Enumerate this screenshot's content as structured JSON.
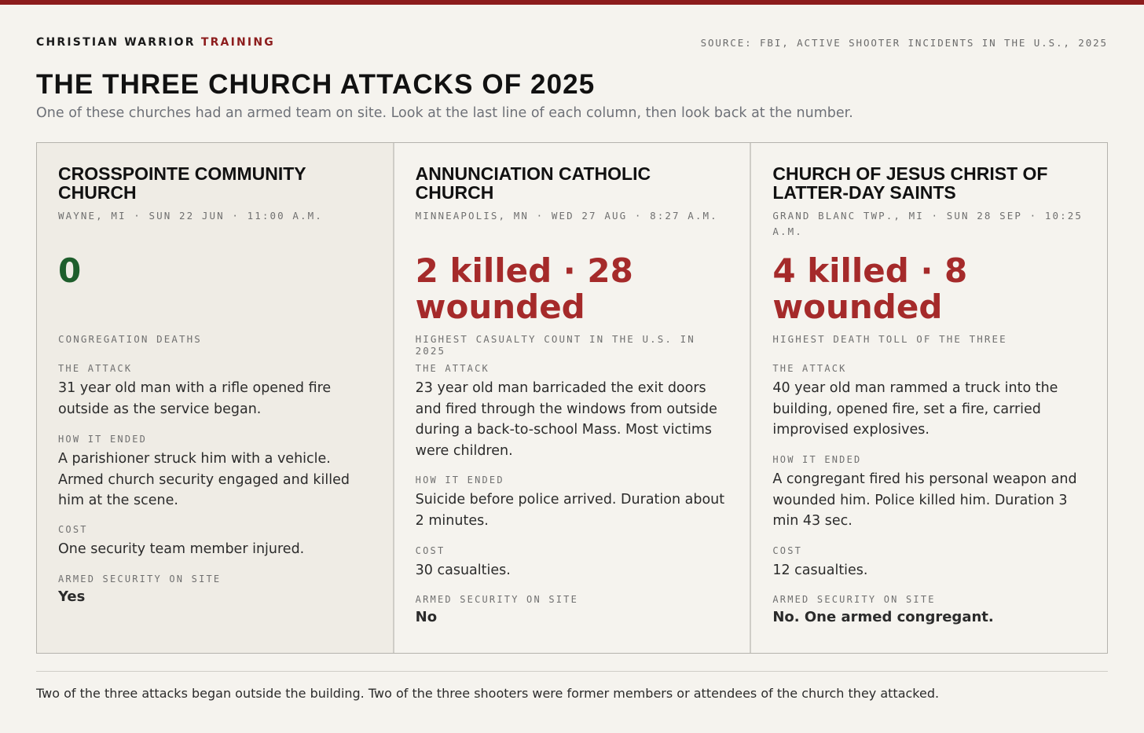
{
  "brand": {
    "primary": "CHRISTIAN WARRIOR",
    "accent": "TRAINING"
  },
  "source": "SOURCE: FBI, ACTIVE SHOOTER INCIDENTS IN THE U.S., 2025",
  "title": "THE THREE CHURCH ATTACKS OF 2025",
  "subtitle": "One of these churches had an armed team on site. Look at the last line of each column, then look back at the number.",
  "colors": {
    "accent": "#8c1c1c",
    "good": "#1e5e2c",
    "bad": "#a52a2a",
    "background": "#f5f3ee"
  },
  "labels": {
    "attack": "THE ATTACK",
    "ended": "HOW IT ENDED",
    "cost": "COST",
    "security": "ARMED SECURITY ON SITE"
  },
  "cards": [
    {
      "name": "CROSSPOINTE COMMUNITY CHURCH",
      "meta": "WAYNE, MI · SUN 22 JUN · 11:00 A.M.",
      "figure": "0",
      "caption": "CONGREGATION DEATHS",
      "attack": "31 year old man with a rifle opened fire outside as the service began.",
      "ended": "A parishioner struck him with a vehicle. Armed church security engaged and killed him at the scene.",
      "cost": "One security team member injured.",
      "security": "Yes"
    },
    {
      "name": "ANNUNCIATION CATHOLIC CHURCH",
      "meta": "MINNEAPOLIS, MN · WED 27 AUG · 8:27 A.M.",
      "figure": "2 killed · 28 wounded",
      "caption": "HIGHEST CASUALTY COUNT IN THE U.S. IN 2025",
      "attack": "23 year old man barricaded the exit doors and fired through the windows from outside during a back-to-school Mass. Most victims were children.",
      "ended": "Suicide before police arrived. Duration about 2 minutes.",
      "cost": "30 casualties.",
      "security": "No"
    },
    {
      "name": "CHURCH OF JESUS CHRIST OF LATTER-DAY SAINTS",
      "meta": "GRAND BLANC TWP., MI · SUN 28 SEP · 10:25 A.M.",
      "figure": "4 killed · 8 wounded",
      "caption": "HIGHEST DEATH TOLL OF THE THREE",
      "attack": "40 year old man rammed a truck into the building, opened fire, set a fire, carried improvised explosives.",
      "ended": "A congregant fired his personal weapon and wounded him. Police killed him. Duration 3 min 43 sec.",
      "cost": "12 casualties.",
      "security": "No. One armed congregant."
    }
  ],
  "footer": "Two of the three attacks began outside the building. Two of the three shooters were former members or attendees of the church they attacked."
}
